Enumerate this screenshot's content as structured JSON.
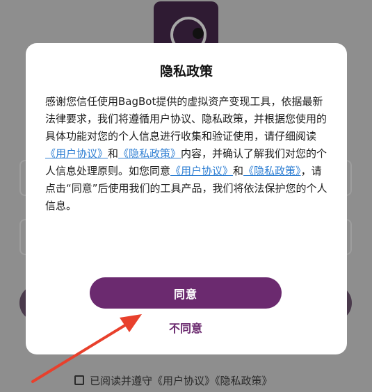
{
  "background": {
    "agree_checkbox_text": "已阅读并遵守《用户协议》《隐私政策》"
  },
  "dialog": {
    "title": "隐私政策",
    "body_part1": "感谢您信任使用BagBot提供的虚拟资产变现工具，依据最新法律要求，我们将遵循用户协议、隐私政策，并根据您使用的具体功能对您的个人信息进行收集和验证使用，请仔细阅读",
    "link_user_agreement_1": "《用户协议》",
    "and_1": "和",
    "link_privacy_policy_1": "《隐私政策》",
    "body_part2": "内容，并确认了解我们对您的个人信息处理原则。如您同意",
    "link_user_agreement_2": "《用户协议》",
    "and_2": "和",
    "link_privacy_policy_2": "《隐私政策》",
    "body_part3": "，请点击“同意”后使用我们的工具产品，我们将依法保护您的个人信息。",
    "agree_label": "同意",
    "disagree_label": "不同意"
  },
  "colors": {
    "accent": "#6b2a6f",
    "link": "#2f7fd3",
    "annotation_arrow": "#e8402c"
  }
}
